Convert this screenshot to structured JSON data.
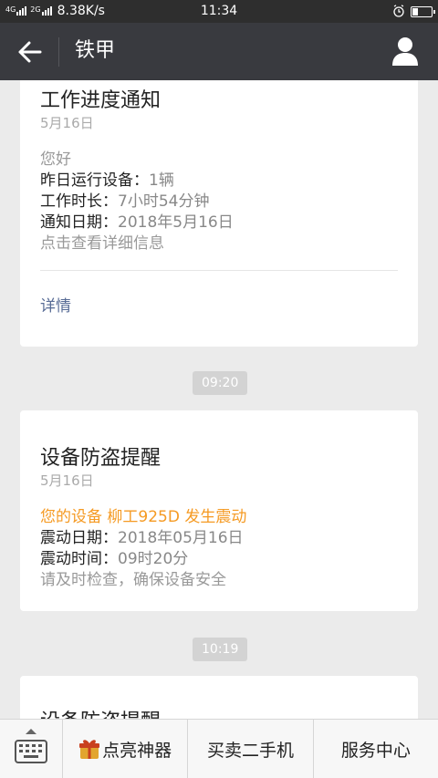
{
  "status_bar": {
    "net_label_1": "4G",
    "net_label_2": "2G",
    "speed": "8.38K/s",
    "time": "11:34",
    "battery_level": 0.3
  },
  "title_bar": {
    "title": "铁甲"
  },
  "messages": [
    {
      "title": "工作进度通知",
      "date": "5月16日",
      "greeting": "您好",
      "fields": [
        {
          "key": "昨日运行设备：",
          "value": "1辆"
        },
        {
          "key": "工作时长：",
          "value": "7小时54分钟"
        },
        {
          "key": "通知日期：",
          "value": "2018年5月16日"
        }
      ],
      "footer_note": "点击查看详细信息",
      "detail_link": "详情"
    },
    {
      "time": "09:20",
      "title": "设备防盗提醒",
      "date": "5月16日",
      "alert": "您的设备 柳工925D 发生震动",
      "fields": [
        {
          "key": "震动日期：",
          "value": "2018年05月16日"
        },
        {
          "key": "震动时间：",
          "value": "09时20分"
        }
      ],
      "footer_note": "请及时检查，确保设备安全"
    },
    {
      "time": "10:19",
      "title": "设备防盗提醒"
    }
  ],
  "bottom_menu": {
    "item1": "点亮神器",
    "item2": "买卖二手机",
    "item3": "服务中心"
  }
}
